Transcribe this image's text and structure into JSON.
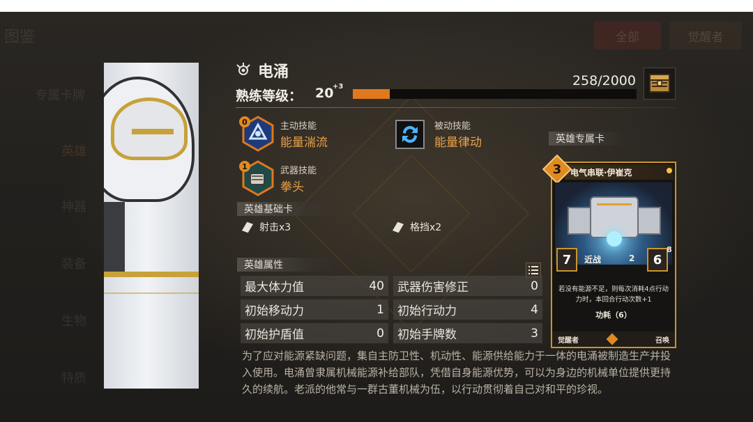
{
  "background": {
    "top_left_text": "图鉴",
    "filter_all": "全部",
    "filter_awakened": "觉醒者",
    "side_menu": [
      "专属卡牌",
      "英雄",
      "神器",
      "装备",
      "生物",
      "特质"
    ]
  },
  "hero": {
    "name": "电涌",
    "level_label": "熟练等级：",
    "level_value": "20",
    "level_bonus": "+3",
    "xp_text": "258/2000",
    "xp_fraction": 0.129
  },
  "skills": [
    {
      "type": "主动技能",
      "name": "能量湍流",
      "badge": "0"
    },
    {
      "type": "被动技能",
      "name": "能量律动",
      "badge": ""
    },
    {
      "type": "武器技能",
      "name": "拳头",
      "badge": "1"
    }
  ],
  "basic_cards": {
    "label": "英雄基础卡",
    "items": [
      "射击x3",
      "格挡x2"
    ]
  },
  "attributes": {
    "label": "英雄属性",
    "rows": [
      {
        "name": "最大体力值",
        "value": "40"
      },
      {
        "name": "武器伤害修正",
        "value": "0"
      },
      {
        "name": "初始移动力",
        "value": "1"
      },
      {
        "name": "初始行动力",
        "value": "4"
      },
      {
        "name": "初始护盾值",
        "value": "0"
      },
      {
        "name": "初始手牌数",
        "value": "3"
      }
    ]
  },
  "exclusive_card": {
    "label": "英雄专属卡",
    "cost": "3",
    "title": "电气串联·伊崔克",
    "attack": "7",
    "range": "近战",
    "mini_value": "2",
    "defense": "6",
    "shield_value": "8",
    "description": "若没有能源不足，则每次消耗4点行动力时，本回合行动次数+1",
    "keyword": "功耗（6）",
    "footer_left": "觉醒者",
    "footer_right": "召唤"
  },
  "description": "为了应对能源紧缺问题，集自主防卫性、机动性、能源供给能力于一体的电涌被制造生产并投入使用。电涌曾隶属机械能源补给部队，凭借自身能源优势，可以为身边的机械单位提供更持久的续航。老派的他常与一群古董机械为伍，以行动贯彻着自己对和平的珍视。",
  "colors": {
    "accent_orange": "#e0781e",
    "skill_name": "#e9a149",
    "card_gold": "#c9962d"
  }
}
